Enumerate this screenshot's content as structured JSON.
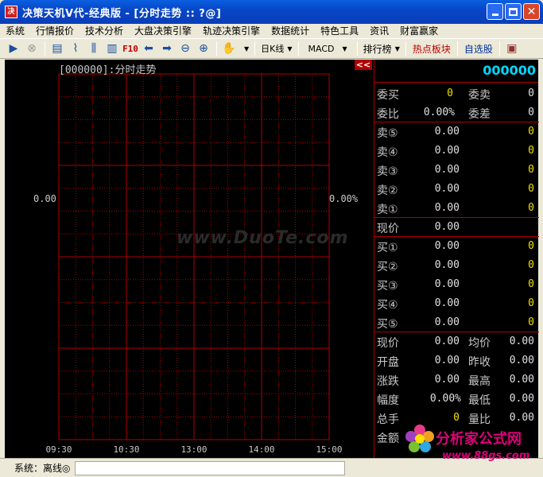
{
  "window": {
    "app_icon_text": "决",
    "title": "决策天机Ⅴ代-经典版 - [分时走势 :: ?@]"
  },
  "menu": [
    "系统",
    "行情报价",
    "技术分析",
    "大盘决策引擎",
    "轨迹决策引擎",
    "数据统计",
    "特色工具",
    "资讯",
    "财富赢家"
  ],
  "toolbar": {
    "f10_label": "F10",
    "period_dropdown": "日K线",
    "indicator_dropdown": "MACD",
    "ranking_dropdown": "排行榜",
    "hot_sectors_label": "热点板块",
    "watchlist_label": "自选股"
  },
  "chart": {
    "title": "[000000]:分时走势",
    "collapse_label": "<<",
    "y_left_label": "0.00",
    "y_right_label": "0.00%",
    "x_ticks": [
      "09:30",
      "10:30",
      "13:00",
      "14:00",
      "15:00"
    ],
    "watermark": "www.DuoTe.com"
  },
  "quote_panel": {
    "stock_code": "000000",
    "weibuy_label": "委买",
    "weibuy_value": "0",
    "weisell_label": "委卖",
    "weisell_value": "0",
    "weibi_label": "委比",
    "weibi_value": "0.00%",
    "weicha_label": "委差",
    "weicha_value": "0",
    "asks": [
      {
        "label": "卖⑤",
        "price": "0.00",
        "volume": "0"
      },
      {
        "label": "卖④",
        "price": "0.00",
        "volume": "0"
      },
      {
        "label": "卖③",
        "price": "0.00",
        "volume": "0"
      },
      {
        "label": "卖②",
        "price": "0.00",
        "volume": "0"
      },
      {
        "label": "卖①",
        "price": "0.00",
        "volume": "0"
      }
    ],
    "current_label": "现价",
    "current_value": "0.00",
    "bids": [
      {
        "label": "买①",
        "price": "0.00",
        "volume": "0"
      },
      {
        "label": "买②",
        "price": "0.00",
        "volume": "0"
      },
      {
        "label": "买③",
        "price": "0.00",
        "volume": "0"
      },
      {
        "label": "买④",
        "price": "0.00",
        "volume": "0"
      },
      {
        "label": "买⑤",
        "price": "0.00",
        "volume": "0"
      }
    ],
    "stats": [
      {
        "l1": "现价",
        "v1": "0.00",
        "l2": "均价",
        "v2": "0.00"
      },
      {
        "l1": "开盘",
        "v1": "0.00",
        "l2": "昨收",
        "v2": "0.00"
      },
      {
        "l1": "涨跌",
        "v1": "0.00",
        "l2": "最高",
        "v2": "0.00"
      },
      {
        "l1": "幅度",
        "v1": "0.00%",
        "l2": "最低",
        "v2": "0.00"
      },
      {
        "l1": "总手",
        "v1": "0",
        "l2": "量比",
        "v2": "0.00"
      },
      {
        "l1": "金额",
        "v1": "",
        "l2": "",
        "v2": ""
      }
    ]
  },
  "status": {
    "text": "系统：离线◎"
  },
  "logo": {
    "text": "分析家公式网",
    "url": "www.88gs.com"
  },
  "colors": {
    "grid": "#B00000",
    "code": "#00D8FF",
    "value_yellow": "#F0E000",
    "logo": "#E0007A"
  }
}
